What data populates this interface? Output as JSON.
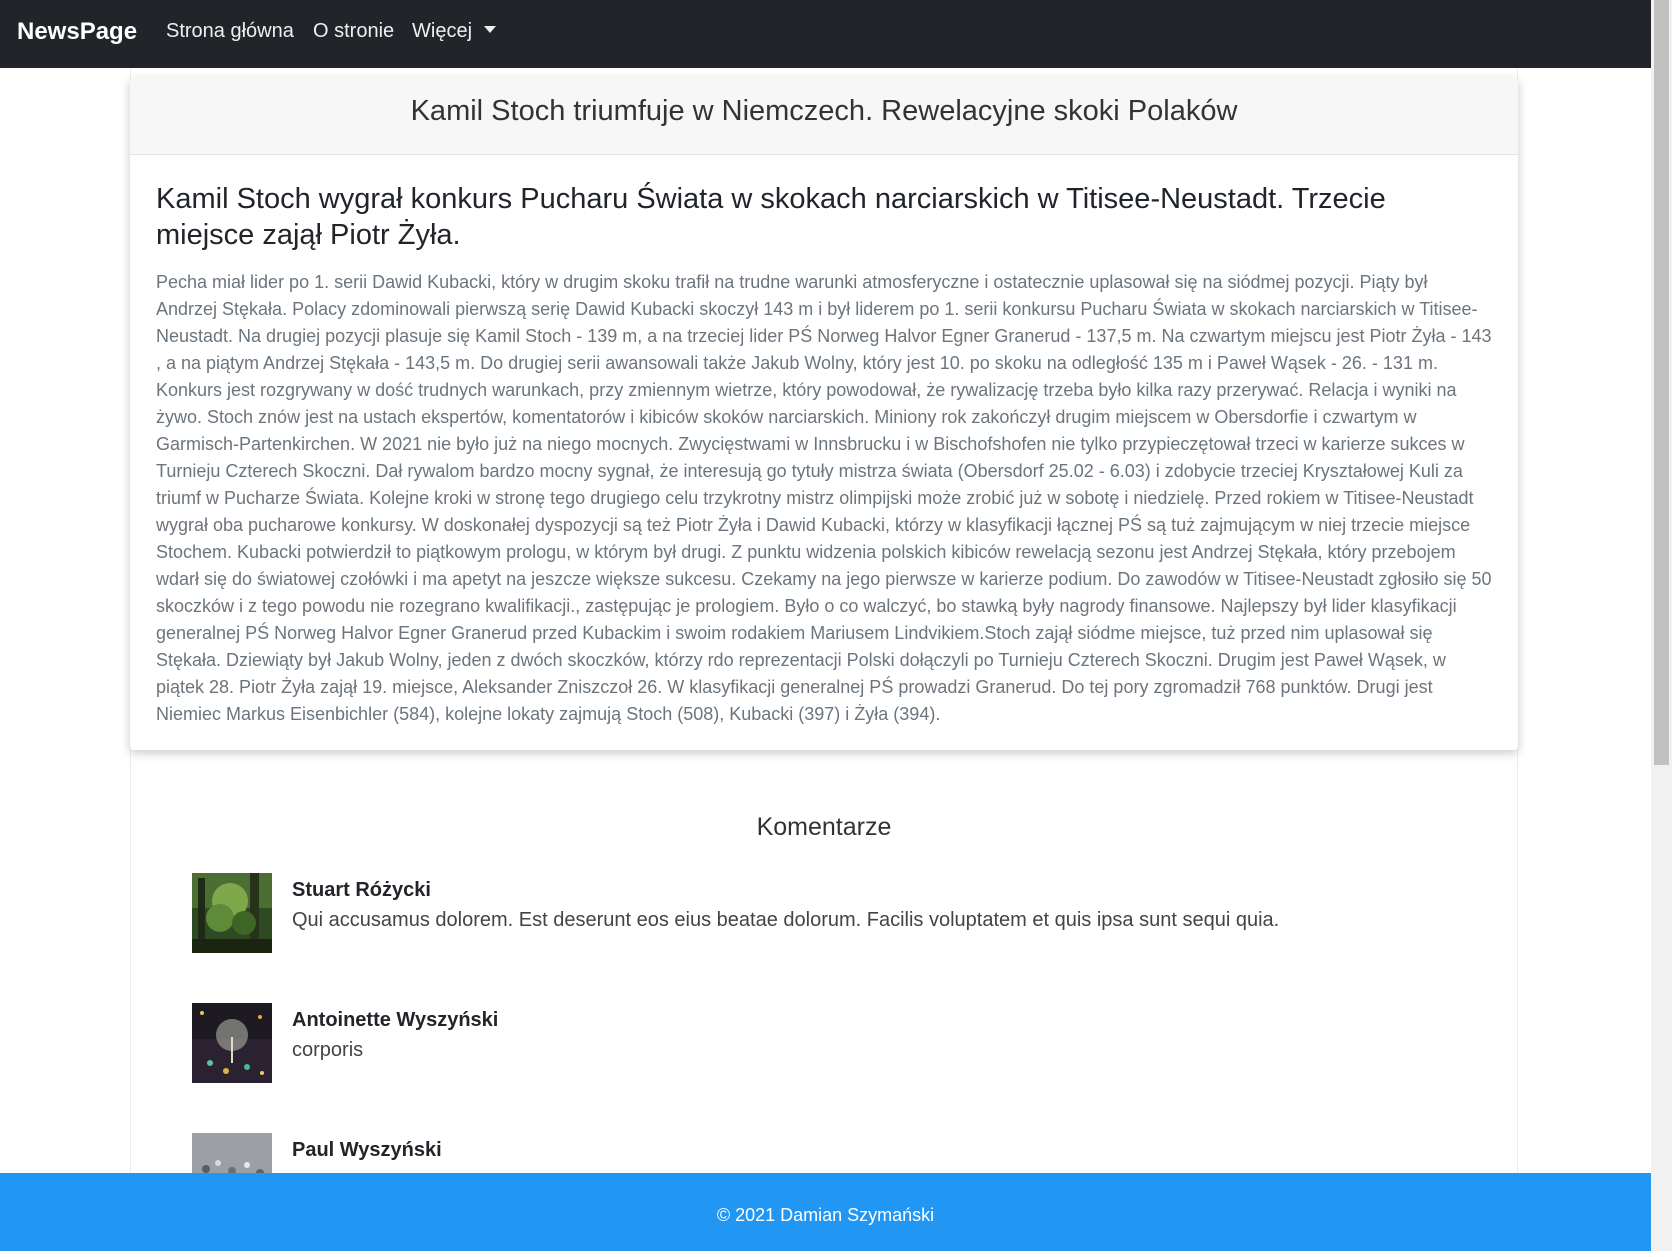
{
  "navbar": {
    "brand": "NewsPage",
    "links": [
      {
        "label": "Strona główna"
      },
      {
        "label": "O stronie"
      },
      {
        "label": "Więcej"
      }
    ]
  },
  "article": {
    "title": "Kamil Stoch triumfuje w Niemczech. Rewelacyjne skoki Polaków",
    "subheading": "Kamil Stoch wygrał konkurs Pucharu Świata w skokach narciarskich w Titisee-Neustadt. Trzecie miejsce zajął Piotr Żyła.",
    "body": "Pecha miał lider po 1. serii Dawid Kubacki, który w drugim skoku trafił na trudne warunki atmosferyczne i ostatecznie uplasował się na siódmej pozycji. Piąty był Andrzej Stękała. Polacy zdominowali pierwszą serię Dawid Kubacki skoczył 143 m i był liderem po 1. serii konkursu Pucharu Świata w skokach narciarskich w Titisee-Neustadt. Na drugiej pozycji plasuje się Kamil Stoch - 139 m, a na trzeciej lider PŚ Norweg Halvor Egner Granerud - 137,5 m. Na czwartym miejscu jest Piotr Żyła - 143 , a na piątym Andrzej Stękała - 143,5 m. Do drugiej serii awansowali także Jakub Wolny, który jest 10. po skoku na odległość 135 m i Paweł Wąsek - 26. - 131 m. Konkurs jest rozgrywany w dość trudnych warunkach, przy zmiennym wietrze, który powodował, że rywalizację trzeba było kilka razy przerywać. Relacja i wyniki na żywo. Stoch znów jest na ustach ekspertów, komentatorów i kibiców skoków narciarskich. Miniony rok zakończył drugim miejscem w Obersdorfie i czwartym w Garmisch-Partenkirchen. W 2021 nie było już na niego mocnych. Zwycięstwami w Innsbrucku i w Bischofshofen nie tylko przypieczętował trzeci w karierze sukces w Turnieju Czterech Skoczni. Dał rywalom bardzo mocny sygnał, że interesują go tytuły mistrza świata (Obersdorf 25.02 - 6.03) i zdobycie trzeciej Kryształowej Kuli za triumf w Pucharze Świata. Kolejne kroki w stronę tego drugiego celu trzykrotny mistrz olimpijski może zrobić już w sobotę i niedzielę. Przed rokiem w Titisee-Neustadt wygrał oba pucharowe konkursy. W doskonałej dyspozycji są też Piotr Żyła i Dawid Kubacki, którzy w klasyfikacji łącznej PŚ są tuż zajmującym w niej trzecie miejsce Stochem. Kubacki potwierdził to piątkowym prologu, w którym był drugi. Z punktu widzenia polskich kibiców rewelacją sezonu jest Andrzej Stękała, który przebojem wdarł się do światowej czołówki i ma apetyt na jeszcze większe sukcesu. Czekamy na jego pierwsze w karierze podium. Do zawodów w Titisee-Neustadt zgłosiło się 50 skoczków i z tego powodu nie rozegrano kwalifikacji., zastępując je prologiem. Było o co walczyć, bo stawką były nagrody finansowe. Najlepszy był lider klasyfikacji generalnej PŚ Norweg Halvor Egner Granerud przed Kubackim i swoim rodakiem Mariusem Lindvikiem.Stoch zajął siódme miejsce, tuż przed nim uplasował się Stękała. Dziewiąty był Jakub Wolny, jeden z dwóch skoczków, którzy rdo reprezentacji Polski dołączyli po Turnieju Czterech Skoczni. Drugim jest Paweł Wąsek, w piątek 28. Piotr Żyła zajął 19. miejsce, Aleksander Zniszczoł 26. W klasyfikacji generalnej PŚ prowadzi Granerud. Do tej pory zgromadził 768 punktów. Drugi jest Niemiec Markus Eisenbichler (584), kolejne lokaty zajmują Stoch (508), Kubacki (397) i Żyła (394)."
  },
  "comments": {
    "heading": "Komentarze",
    "items": [
      {
        "author": "Stuart Różycki",
        "text": "Qui accusamus dolorem. Est deserunt eos eius beatae dolorum. Facilis voluptatem et quis ipsa sunt sequi quia."
      },
      {
        "author": "Antoinette Wyszyński",
        "text": "corporis"
      },
      {
        "author": "Paul Wyszyński",
        "text": ""
      }
    ]
  },
  "footer": {
    "text": "© 2021 Damian Szymański"
  },
  "colors": {
    "navbar": "#212529",
    "footer": "#2196f3",
    "muted_text": "#6c757d"
  }
}
